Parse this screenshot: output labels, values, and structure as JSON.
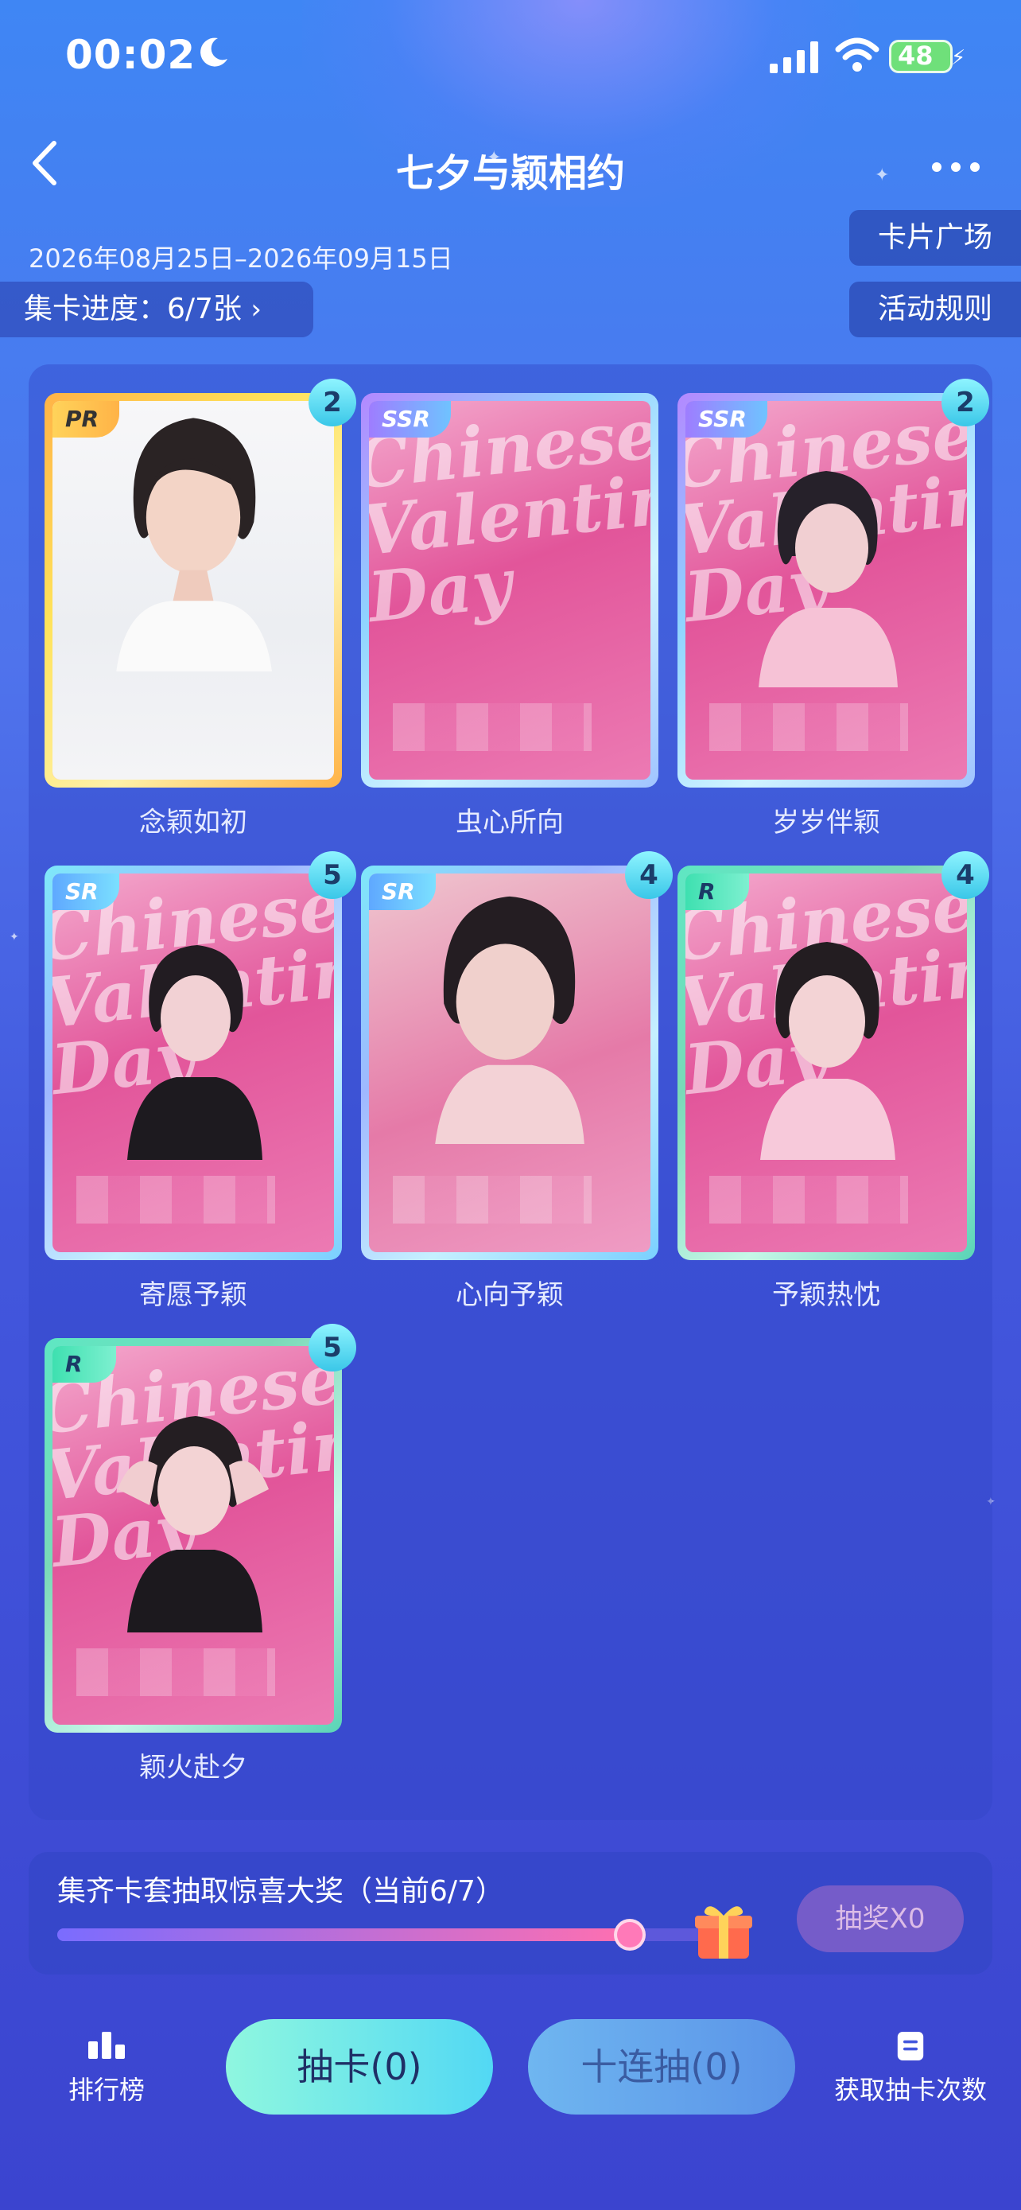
{
  "status_bar": {
    "time": "00:02",
    "battery": "48"
  },
  "header": {
    "title": "七夕与颖相约"
  },
  "event": {
    "dates": "2026年08月25日–2026年09月15日",
    "progress_label": "集卡进度：6/7张",
    "card_square": "卡片广场",
    "rules": "活动规则"
  },
  "cards": [
    {
      "rarity": "PR",
      "count": "2",
      "name": "念颖如初"
    },
    {
      "rarity": "SSR",
      "count": "",
      "name": "虫心所向"
    },
    {
      "rarity": "SSR",
      "count": "2",
      "name": "岁岁伴颖"
    },
    {
      "rarity": "SR",
      "count": "5",
      "name": "寄愿予颖"
    },
    {
      "rarity": "SR",
      "count": "4",
      "name": "心向予颖"
    },
    {
      "rarity": "R",
      "count": "4",
      "name": "予颖热忱"
    },
    {
      "rarity": "R",
      "count": "5",
      "name": "颖火赴夕"
    }
  ],
  "card_decor_text": "Chinese Valentine's Day",
  "reward": {
    "text": "集齐卡套抽取惊喜大奖（当前6/7）",
    "progress": 0.857,
    "lottery_label": "抽奖X0"
  },
  "bottom": {
    "rank_label": "排行榜",
    "draw_label": "抽卡(0)",
    "draw10_label": "十连抽(0)",
    "get_chances_label": "获取抽卡次数"
  },
  "colors": {
    "accent": "#52d8f4",
    "panel": "#3244c8",
    "pink": "#e2559a"
  },
  "icons": [
    "moon-icon",
    "signal-icon",
    "wifi-icon",
    "battery-icon",
    "back-arrow-icon",
    "more-icon",
    "chevron-right-icon",
    "gift-icon",
    "ranking-icon",
    "document-icon"
  ]
}
